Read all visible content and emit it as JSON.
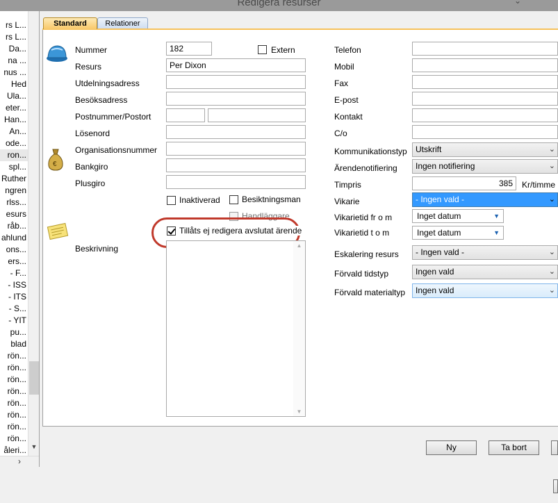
{
  "window": {
    "title": "Redigera resurser"
  },
  "left_list": [
    "rs L...",
    "rs L...",
    "Da...",
    "na ...",
    "nus ...",
    "Hed",
    "Ula...",
    "eter...",
    "Han...",
    "An...",
    "ode...",
    "ron...",
    "spl...",
    "Ruther",
    "ngren",
    "rlss...",
    "esurs",
    "råb...",
    "ahlund",
    "ons...",
    "ers...",
    "- F...",
    "- ISS",
    "- ITS",
    "- S...",
    "- YIT",
    "pu...",
    "blad",
    "rön...",
    "rön...",
    "rön...",
    "rön...",
    "rön...",
    "rön...",
    "rön...",
    "rön...",
    "åleri..."
  ],
  "tabs": {
    "standard": "Standard",
    "relationer": "Relationer"
  },
  "form": {
    "nummer_label": "Nummer",
    "nummer_value": "182",
    "extern_label": "Extern",
    "resurs_label": "Resurs",
    "resurs_value": "Per Dixon",
    "utdelningsadress_label": "Utdelningsadress",
    "besoksadress_label": "Besöksadress",
    "postnummer_label": "Postnummer/Postort",
    "losenord_label": "Lösenord",
    "organisationsnummer_label": "Organisationsnummer",
    "bankgiro_label": "Bankgiro",
    "plusgiro_label": "Plusgiro",
    "inaktiverad_label": "Inaktiverad",
    "besiktningsman_label": "Besiktningsman",
    "handlaggare_label": "Handläggare",
    "tillats_label": "Tillåts ej redigera avslutat ärende",
    "beskrivning_label": "Beskrivning",
    "telefon_label": "Telefon",
    "mobil_label": "Mobil",
    "fax_label": "Fax",
    "epost_label": "E-post",
    "kontakt_label": "Kontakt",
    "co_label": "C/o",
    "kommunikationstyp_label": "Kommunikationstyp",
    "kommunikationstyp_value": "Utskrift",
    "arendenotifiering_label": "Ärendenotifiering",
    "arendenotifiering_value": "Ingen notifiering",
    "timpris_label": "Timpris",
    "timpris_value": "385",
    "timpris_unit": "Kr/timme",
    "vikarie_label": "Vikarie",
    "vikarie_value": "- Ingen vald -",
    "vikarietid_from_label": "Vikarietid fr o m",
    "vikarietid_from_value": "Inget datum",
    "vikarietid_tom_label": "Vikarietid t o m",
    "vikarietid_tom_value": "Inget datum",
    "eskalering_label": "Eskalering resurs",
    "eskalering_value": "- Ingen vald -",
    "forvald_tidstyp_label": "Förvald tidstyp",
    "forvald_tidstyp_value": "Ingen vald",
    "forvald_materialtyp_label": "Förvald materialtyp",
    "forvald_materialtyp_value": "Ingen vald"
  },
  "buttons": {
    "ny": "Ny",
    "ta_bort": "Ta bort"
  },
  "icons": [
    "helmet-icon",
    "money-bag-icon",
    "note-icon"
  ],
  "colors": {
    "tab_active": "#f8c86a",
    "highlight": "#c0392b",
    "selection": "#3399ff"
  }
}
